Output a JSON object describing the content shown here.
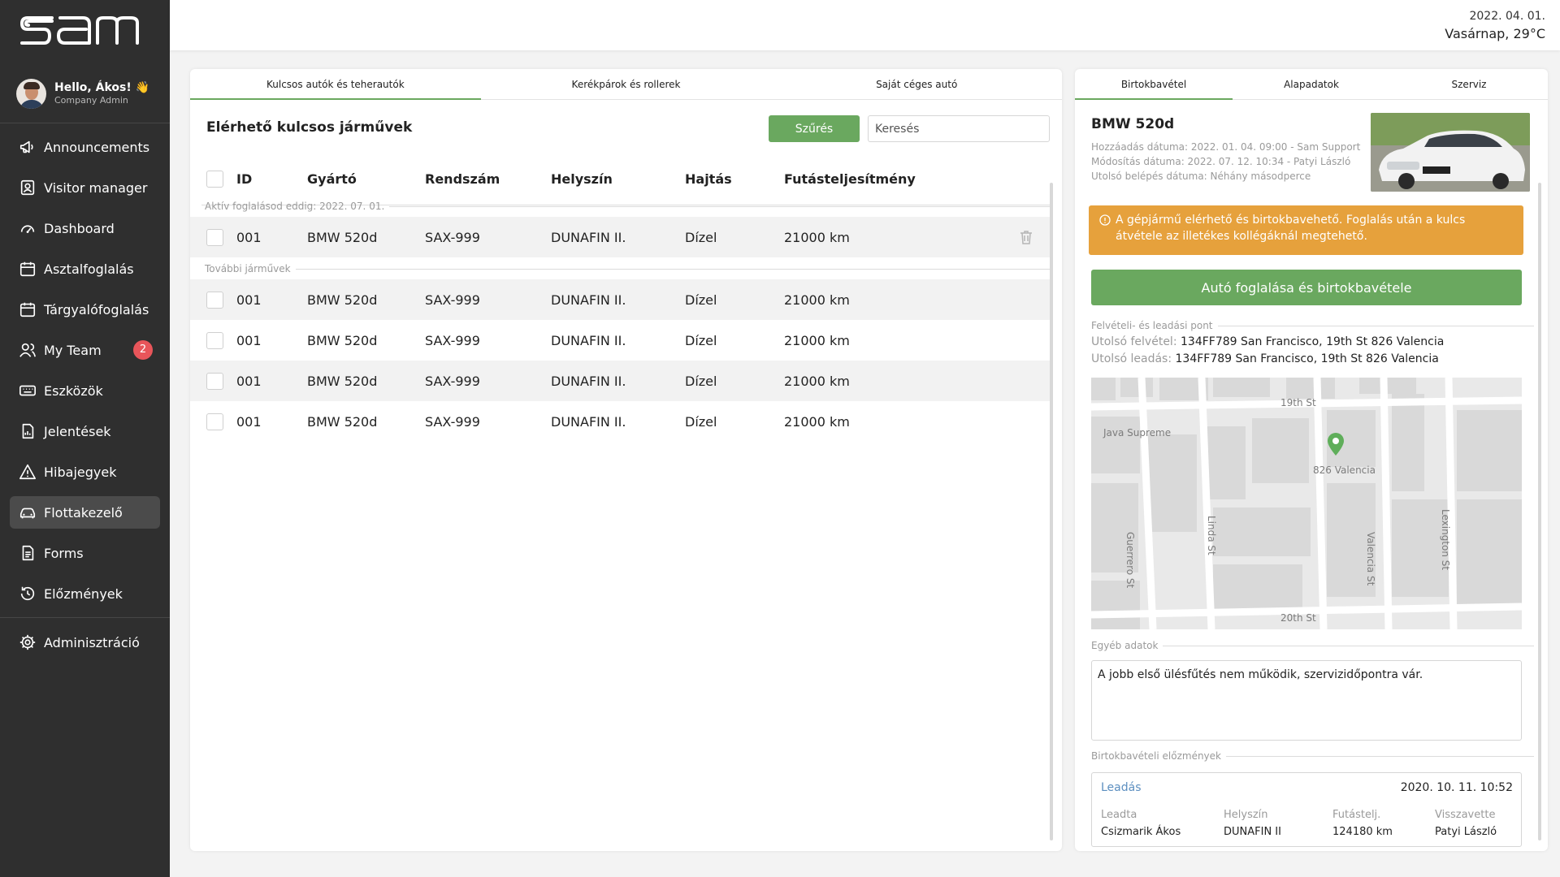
{
  "app": {
    "logo_text": "sam"
  },
  "user": {
    "greeting": "Hello, Ákos! 👋",
    "role": "Company Admin"
  },
  "nav": [
    {
      "label": "Announcements",
      "icon": "megaphone-icon"
    },
    {
      "label": "Visitor manager",
      "icon": "visitor-badge-icon"
    },
    {
      "label": "Dashboard",
      "icon": "gauge-icon"
    },
    {
      "label": "Asztalfoglalás",
      "icon": "calendar-icon"
    },
    {
      "label": "Tárgyalófoglalás",
      "icon": "calendar-icon"
    },
    {
      "label": "My Team",
      "icon": "team-icon",
      "badge": "2"
    },
    {
      "label": "Eszközök",
      "icon": "keyboard-icon"
    },
    {
      "label": "Jelentések",
      "icon": "report-icon"
    },
    {
      "label": "Hibajegyek",
      "icon": "warning-icon"
    },
    {
      "label": "Flottakezelő",
      "icon": "car-icon",
      "active": true
    },
    {
      "label": "Forms",
      "icon": "form-icon"
    },
    {
      "label": "Előzmények",
      "icon": "history-icon"
    },
    {
      "label": "Adminisztráció",
      "icon": "settings-icon"
    }
  ],
  "topbar": {
    "date": "2022. 04. 01.",
    "weather": "Vasárnap, 29°C"
  },
  "left": {
    "tabs": [
      "Kulcsos autók és teherautók",
      "Kerékpárok és rollerek",
      "Saját céges autó"
    ],
    "title": "Elérhető kulcsos járművek",
    "filter_label": "Szűrés",
    "search_placeholder": "Keresés",
    "columns": [
      "ID",
      "Gyártó",
      "Rendszám",
      "Helyszín",
      "Hajtás",
      "Futásteljesítmény"
    ],
    "active_section": "Aktív foglalásod eddig: 2022. 07. 01.",
    "active_rows": [
      {
        "id": "001",
        "make": "BMW 520d",
        "plate": "SAX-999",
        "location": "DUNAFIN II.",
        "drive": "Dízel",
        "mileage": "21000 km"
      }
    ],
    "more_section": "További járművek",
    "rows": [
      {
        "id": "001",
        "make": "BMW 520d",
        "plate": "SAX-999",
        "location": "DUNAFIN II.",
        "drive": "Dízel",
        "mileage": "21000 km"
      },
      {
        "id": "001",
        "make": "BMW 520d",
        "plate": "SAX-999",
        "location": "DUNAFIN II.",
        "drive": "Dízel",
        "mileage": "21000 km"
      },
      {
        "id": "001",
        "make": "BMW 520d",
        "plate": "SAX-999",
        "location": "DUNAFIN II.",
        "drive": "Dízel",
        "mileage": "21000 km"
      },
      {
        "id": "001",
        "make": "BMW 520d",
        "plate": "SAX-999",
        "location": "DUNAFIN II.",
        "drive": "Dízel",
        "mileage": "21000 km"
      }
    ]
  },
  "right": {
    "tabs": [
      "Birtokbavétel",
      "Alapadatok",
      "Szerviz"
    ],
    "car_title": "BMW 520d",
    "meta": [
      "Hozzáadás dátuma: 2022. 01. 04. 09:00 - Sam Support",
      "Módosítás dátuma: 2022. 07. 12. 10:34 - Patyi László",
      "Utolsó belépés dátuma: Néhány másodperce"
    ],
    "warning": "A gépjármű elérhető és birtokbavehető. Foglalás után a kulcs átvétele az illetékes kollégáknál megtehető.",
    "book_button": "Autó foglalása és birtokbavétele",
    "pickup_section": "Felvételi- és leadási pont",
    "last_pickup_label": "Utolsó felvétel:",
    "last_pickup": "134FF789 San Francisco, 19th St 826 Valencia",
    "last_dropoff_label": "Utolsó leadás:",
    "last_dropoff": "134FF789 San Francisco, 19th St 826 Valencia",
    "map": {
      "labels": [
        "19th St",
        "Java Supreme",
        "826 Valencia",
        "Guerrero St",
        "Linda St",
        "Valencia St",
        "Lexington St",
        "20th St"
      ]
    },
    "other_section": "Egyéb adatok",
    "notes": "A jobb első ülésfűtés nem működik, szervizidőpontra vár.",
    "history_section": "Birtokbavételi előzmények",
    "history": {
      "action": "Leadás",
      "datetime": "2020. 10. 11. 10:52",
      "cols": [
        {
          "key": "Leadta",
          "value": "Csizmarik Ákos"
        },
        {
          "key": "Helyszín",
          "value": "DUNAFIN II"
        },
        {
          "key": "Futástelj.",
          "value": "124180 km"
        },
        {
          "key": "Visszavette",
          "value": "Patyi László"
        }
      ]
    }
  },
  "colors": {
    "accent": "#6aa85f",
    "warning": "#e6a13c",
    "sidebar": "#2f2f2f",
    "badge": "#e8555a",
    "link": "#5c8fc0"
  }
}
